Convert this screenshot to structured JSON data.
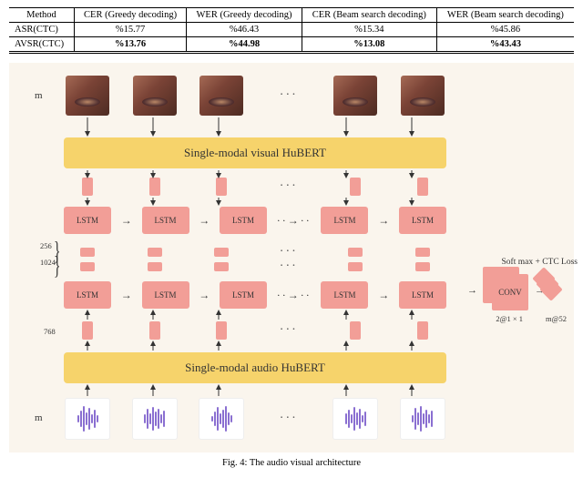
{
  "table": {
    "headers": [
      "Method",
      "CER (Greedy decoding)",
      "WER (Greedy decoding)",
      "CER (Beam search decoding)",
      "WER (Beam search decoding)"
    ],
    "rows": [
      {
        "method": "ASR(CTC)",
        "cer_g": "%15.77",
        "wer_g": "%46.43",
        "cer_b": "%15.34",
        "wer_b": "%45.86",
        "bold": false
      },
      {
        "method": "AVSR(CTC)",
        "cer_g": "%13.76",
        "wer_g": "%44.98",
        "cer_b": "%13.08",
        "wer_b": "%43.43",
        "bold": true
      }
    ]
  },
  "figure": {
    "m_label": "m",
    "hubert_visual": "Single-modal visual HuBERT",
    "hubert_audio": "Single-modal audio HuBERT",
    "lstm": "LSTM",
    "conv": "CONV",
    "dim256": "256",
    "dim1024": "1024",
    "dim768": "768",
    "conv_shape": "2@1 × 1",
    "out_shape": "m@52",
    "loss": "Soft max + CTC Loss",
    "caption": "Fig. 4: The audio visual architecture"
  },
  "chart_data": {
    "type": "table",
    "title": "ASR vs AVSR error rates",
    "columns": [
      "Method",
      "CER Greedy",
      "WER Greedy",
      "CER Beam",
      "WER Beam"
    ],
    "rows": [
      [
        "ASR(CTC)",
        15.77,
        46.43,
        15.34,
        45.86
      ],
      [
        "AVSR(CTC)",
        13.76,
        44.98,
        13.08,
        43.43
      ]
    ]
  }
}
